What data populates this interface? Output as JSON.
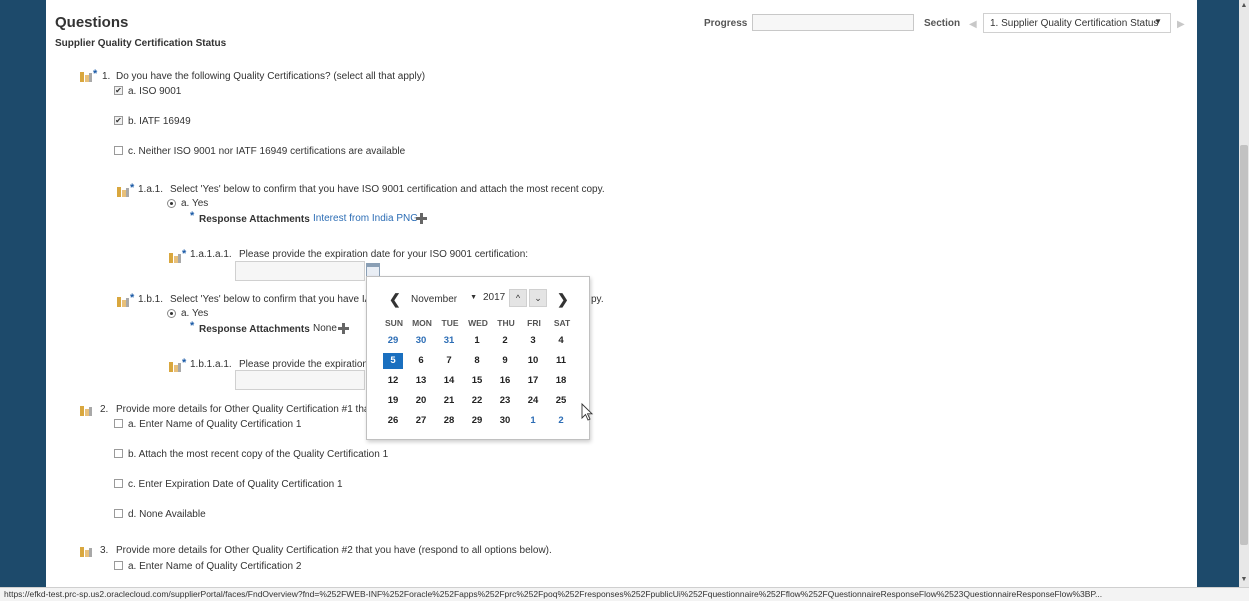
{
  "header": {
    "title": "Questions",
    "subtitle": "Supplier Quality Certification Status",
    "progress_label": "Progress",
    "section_label": "Section",
    "section_value": "1. Supplier Quality Certification Status",
    "section_caret": "▼",
    "prev_arrow": "◀",
    "next_arrow": "▶"
  },
  "q1": {
    "number": "1.",
    "text": "Do you have the following Quality Certifications? (select all that apply)",
    "options": [
      {
        "label": "a. ISO 9001",
        "checked": true
      },
      {
        "label": "b. IATF 16949",
        "checked": true
      },
      {
        "label": "c. Neither ISO 9001 nor IATF 16949 certifications are available",
        "checked": false
      }
    ]
  },
  "q1a1": {
    "number": "1.a.1.",
    "text": "Select 'Yes' below to confirm that you have ISO 9001 certification and attach the most recent copy.",
    "option": "a. Yes",
    "attachments_label": "Response Attachments",
    "attachments_value": "Interest from India PNG"
  },
  "q1a1a1": {
    "number": "1.a.1.a.1.",
    "text": "Please provide the expiration date for your ISO 9001 certification:"
  },
  "q1b1": {
    "number": "1.b.1.",
    "text_left": "Select 'Yes' below to confirm that you have IA",
    "text_right": "py.",
    "option": "a. Yes",
    "attachments_label": "Response Attachments",
    "attachments_value": "None"
  },
  "q1b1a1": {
    "number": "1.b.1.a.1.",
    "text": "Please provide the expiration"
  },
  "q2": {
    "number": "2.",
    "text": "Provide more details for Other Quality Certification #1 that",
    "options": [
      {
        "label": "a. Enter Name of Quality Certification 1",
        "checked": false
      },
      {
        "label": "b. Attach the most recent copy of the Quality Certification 1",
        "checked": false
      },
      {
        "label": "c. Enter Expiration Date of Quality Certification 1",
        "checked": false
      },
      {
        "label": "d. None Available",
        "checked": false
      }
    ]
  },
  "q3": {
    "number": "3.",
    "text": "Provide more details for Other Quality Certification #2 that you have (respond to all options below).",
    "options": [
      {
        "label": "a. Enter Name of Quality Certification 2",
        "checked": false
      }
    ]
  },
  "calendar": {
    "prev": "❮",
    "next": "❯",
    "month": "November",
    "year": "2017",
    "spin_up": "^",
    "spin_down": "⌄",
    "dows": [
      "SUN",
      "MON",
      "TUE",
      "WED",
      "THU",
      "FRI",
      "SAT"
    ],
    "weeks": [
      [
        "29",
        "30",
        "31",
        "1",
        "2",
        "3",
        "4"
      ],
      [
        "5",
        "6",
        "7",
        "8",
        "9",
        "10",
        "11"
      ],
      [
        "12",
        "13",
        "14",
        "15",
        "16",
        "17",
        "18"
      ],
      [
        "19",
        "20",
        "21",
        "22",
        "23",
        "24",
        "25"
      ],
      [
        "26",
        "27",
        "28",
        "29",
        "30",
        "1",
        "2"
      ]
    ],
    "selected": "5"
  },
  "status_url": "https://efkd-test.prc-sp.us2.oraclecloud.com/supplierPortal/faces/FndOverview?fnd=%252FWEB-INF%252Foracle%252Fapps%252Fprc%252Fpoq%252Fresponses%252FpublicUi%252Fquestionnaire%252Fflow%252FQuestionnaireResponseFlow%2523QuestionnaireResponseFlow%3BP...",
  "colors": {
    "frame": "#1d4a6b",
    "link": "#2c6db5",
    "selected_day": "#1a6fbf"
  }
}
